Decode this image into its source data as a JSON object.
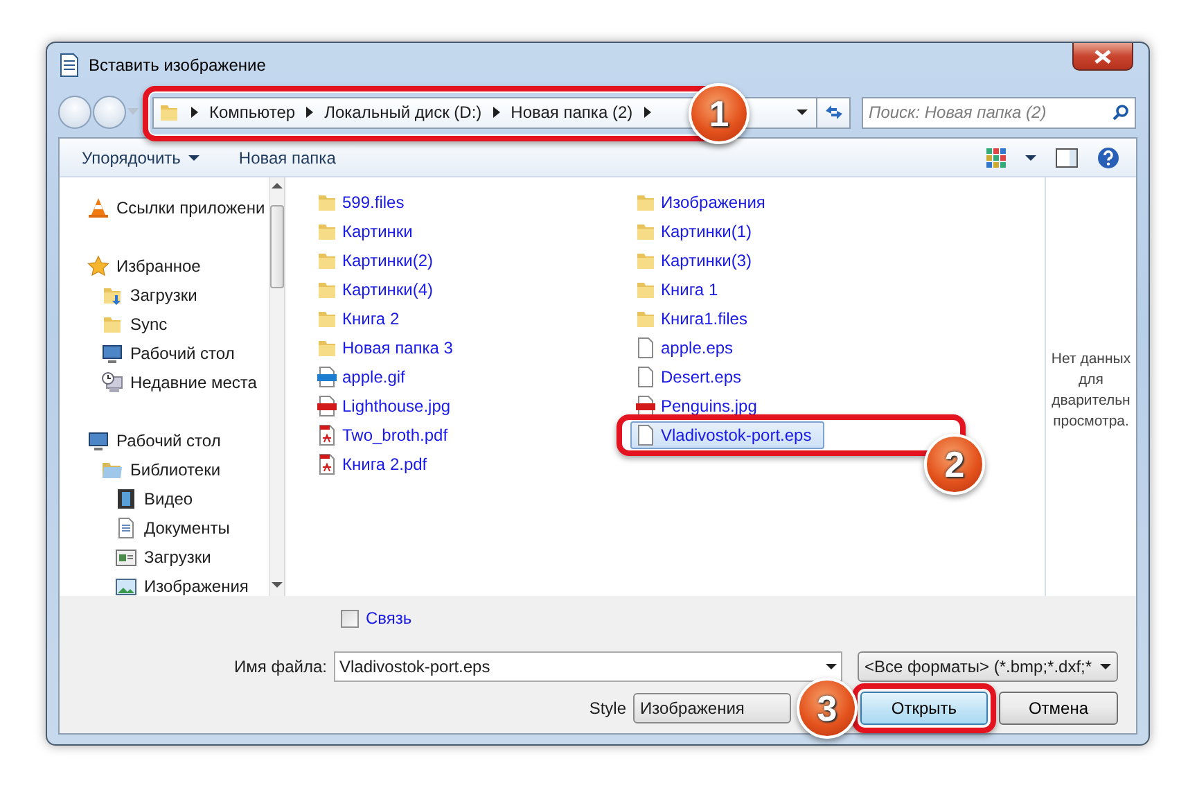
{
  "window": {
    "title": "Вставить изображение"
  },
  "address": {
    "segments": [
      "Компьютер",
      "Локальный диск (D:)",
      "Новая папка (2)"
    ],
    "callout": "1"
  },
  "search": {
    "placeholder": "Поиск: Новая папка (2)"
  },
  "toolbar": {
    "buttons": [
      {
        "label": "Упорядочить",
        "dropdown": true
      },
      {
        "label": "Новая папка",
        "dropdown": false
      }
    ]
  },
  "navigation": [
    {
      "label": "Ссылки приложени",
      "kind": "cone"
    },
    {
      "label": "Избранное",
      "kind": "star",
      "children": [
        {
          "label": "Загрузки",
          "kind": "downloads"
        },
        {
          "label": "Sync",
          "kind": "folder"
        },
        {
          "label": "Рабочий стол",
          "kind": "desktop"
        },
        {
          "label": "Недавние места",
          "kind": "recent"
        }
      ]
    },
    {
      "label": "Рабочий стол",
      "kind": "desktop",
      "children": [
        {
          "label": "Библиотеки",
          "kind": "library",
          "children": [
            {
              "label": "Видео",
              "kind": "video"
            },
            {
              "label": "Документы",
              "kind": "document"
            },
            {
              "label": "Загрузки",
              "kind": "window"
            },
            {
              "label": "Изображения",
              "kind": "pictures"
            }
          ]
        }
      ]
    }
  ],
  "files": [
    {
      "name": "599.files",
      "kind": "folder",
      "selected": false
    },
    {
      "name": "Картинки",
      "kind": "folder",
      "selected": false
    },
    {
      "name": "Картинки(2)",
      "kind": "folder",
      "selected": false
    },
    {
      "name": "Картинки(4)",
      "kind": "folder",
      "selected": false
    },
    {
      "name": "Книга 2",
      "kind": "folder",
      "selected": false
    },
    {
      "name": "Новая папка 3",
      "kind": "folder",
      "selected": false
    },
    {
      "name": "apple.gif",
      "kind": "gif",
      "selected": false
    },
    {
      "name": "Lighthouse.jpg",
      "kind": "jpg",
      "selected": false
    },
    {
      "name": "Two_broth.pdf",
      "kind": "pdf",
      "selected": false
    },
    {
      "name": "Книга 2.pdf",
      "kind": "pdf",
      "selected": false
    },
    {
      "name": "Изображения",
      "kind": "folder",
      "selected": false
    },
    {
      "name": "Картинки(1)",
      "kind": "folder",
      "selected": false
    },
    {
      "name": "Картинки(3)",
      "kind": "folder",
      "selected": false
    },
    {
      "name": "Книга 1",
      "kind": "folder",
      "selected": false
    },
    {
      "name": "Книга1.files",
      "kind": "folder",
      "selected": false
    },
    {
      "name": "apple.eps",
      "kind": "eps",
      "selected": false
    },
    {
      "name": "Desert.eps",
      "kind": "eps",
      "selected": false
    },
    {
      "name": "Penguins.jpg",
      "kind": "jpg",
      "selected": false
    },
    {
      "name": "Vladivostok-port.eps",
      "kind": "eps",
      "selected": true,
      "callout": "2"
    }
  ],
  "preview": {
    "message_lines": [
      "Нет данных",
      "для",
      "дварительн",
      "просмотра."
    ]
  },
  "link_checkbox": {
    "label": "Связь",
    "checked": false
  },
  "filename": {
    "label": "Имя файла:",
    "value": "Vladivostok-port.eps"
  },
  "filter": {
    "value": "<Все форматы> (*.bmp;*.dxf;*"
  },
  "style": {
    "label": "Style",
    "value": "Изображения"
  },
  "buttons": [
    {
      "label": "Открыть",
      "default": true,
      "callout": "3"
    },
    {
      "label": "Отмена",
      "default": false
    }
  ]
}
